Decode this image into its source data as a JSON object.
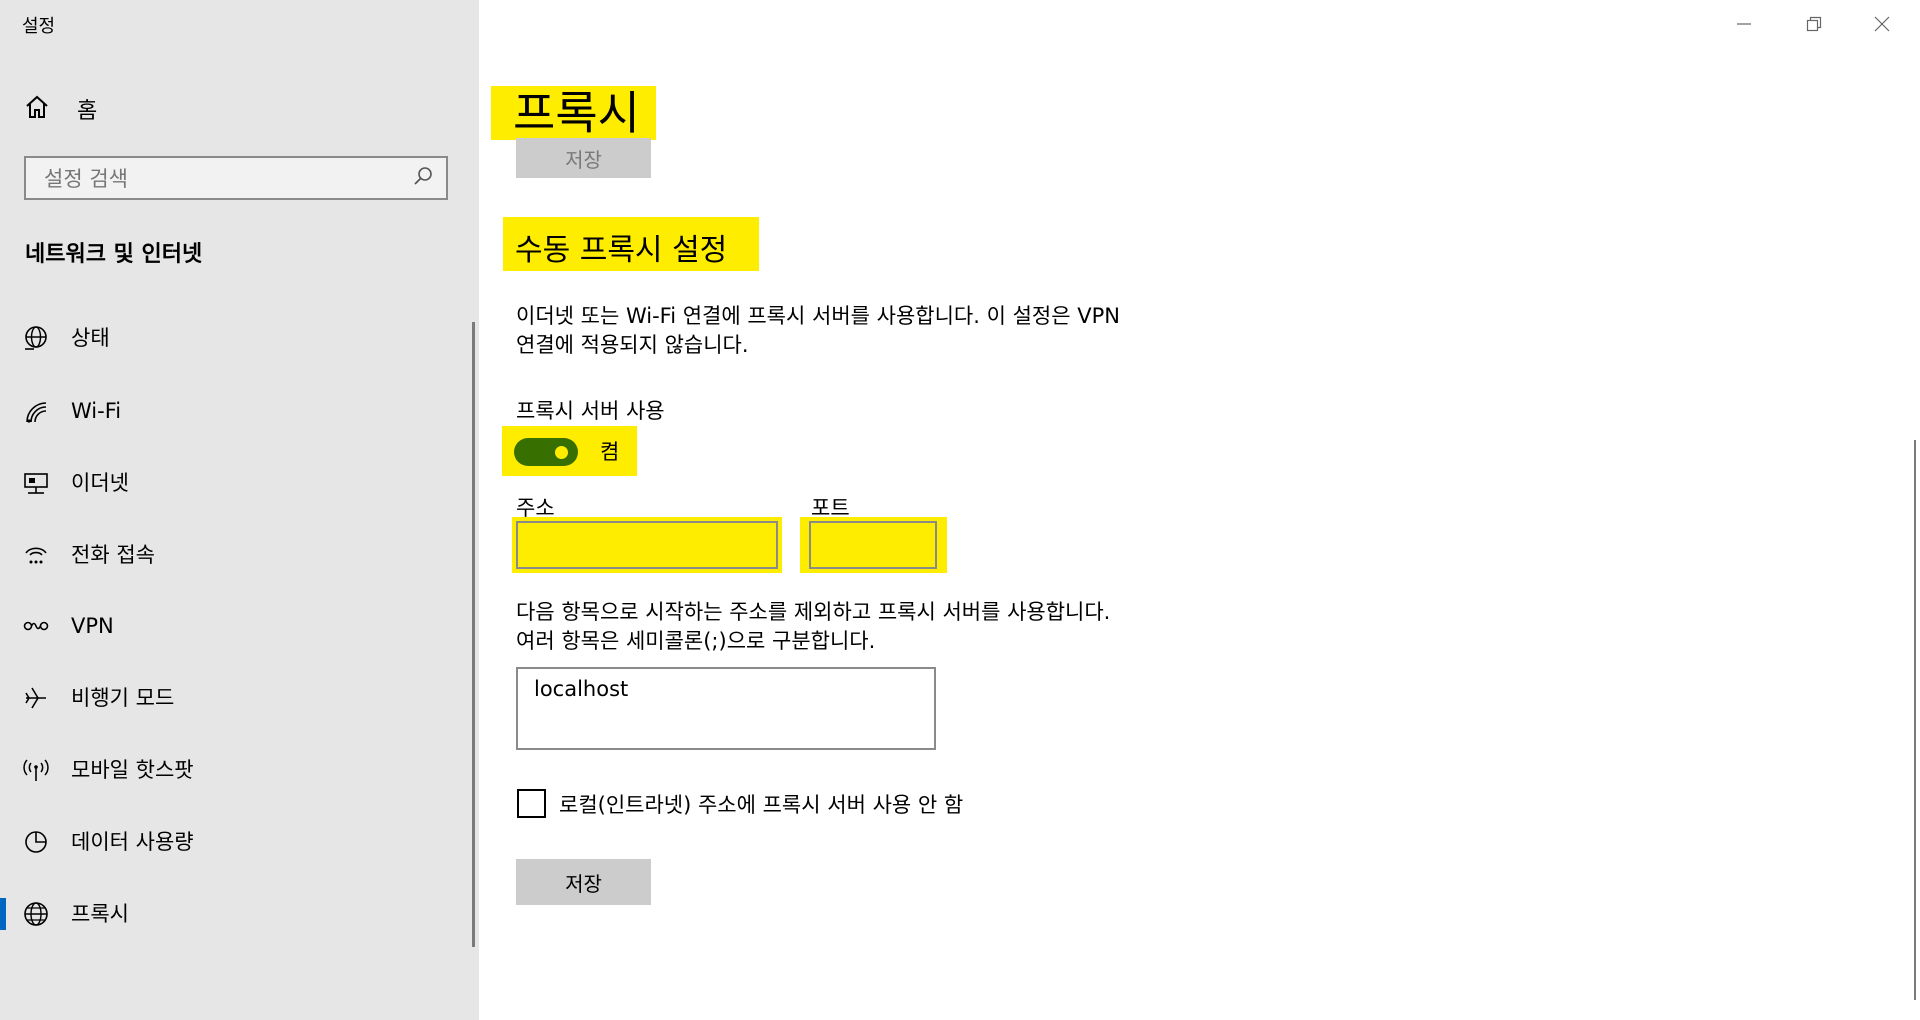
{
  "window": {
    "title": "설정",
    "controls": [
      "minimize-icon",
      "restore-icon",
      "close-icon"
    ]
  },
  "sidebar": {
    "home_label": "홈",
    "search_placeholder": "설정 검색",
    "section_title": "네트워크 및 인터넷",
    "items": [
      {
        "label": "상태",
        "icon": "globe-status-icon"
      },
      {
        "label": "Wi-Fi",
        "icon": "wifi-icon"
      },
      {
        "label": "이더넷",
        "icon": "ethernet-icon"
      },
      {
        "label": "전화 접속",
        "icon": "dialup-icon"
      },
      {
        "label": "VPN",
        "icon": "vpn-icon"
      },
      {
        "label": "비행기 모드",
        "icon": "airplane-icon"
      },
      {
        "label": "모바일 핫스팟",
        "icon": "hotspot-icon"
      },
      {
        "label": "데이터 사용량",
        "icon": "data-usage-icon"
      },
      {
        "label": "프록시",
        "icon": "globe-icon",
        "active": true
      }
    ]
  },
  "main": {
    "title": "프록시",
    "save_top_label": "저장",
    "manual_section_title": "수동 프록시 설정",
    "manual_description_line1": "이더넷 또는 Wi-Fi 연결에 프록시 서버를 사용합니다. 이 설정은 VPN",
    "manual_description_line2": "연결에 적용되지 않습니다.",
    "use_proxy_label": "프록시 서버 사용",
    "toggle_state_label": "켬",
    "address_label": "주소",
    "address_value": "",
    "port_label": "포트",
    "port_value": "",
    "exclusion_description_line1": "다음 항목으로 시작하는 주소를 제외하고 프록시 서버를 사용합니다.",
    "exclusion_description_line2": "여러 항목은 세미콜론(;)으로 구분합니다.",
    "exclusion_value": "localhost",
    "bypass_local_label": "로컬(인트라넷) 주소에 프록시 서버 사용 안 함",
    "bypass_local_checked": false,
    "save_bottom_label": "저장",
    "toggle_on": true,
    "highlight_color": "#ffed00",
    "toggle_color": "#376f00"
  }
}
